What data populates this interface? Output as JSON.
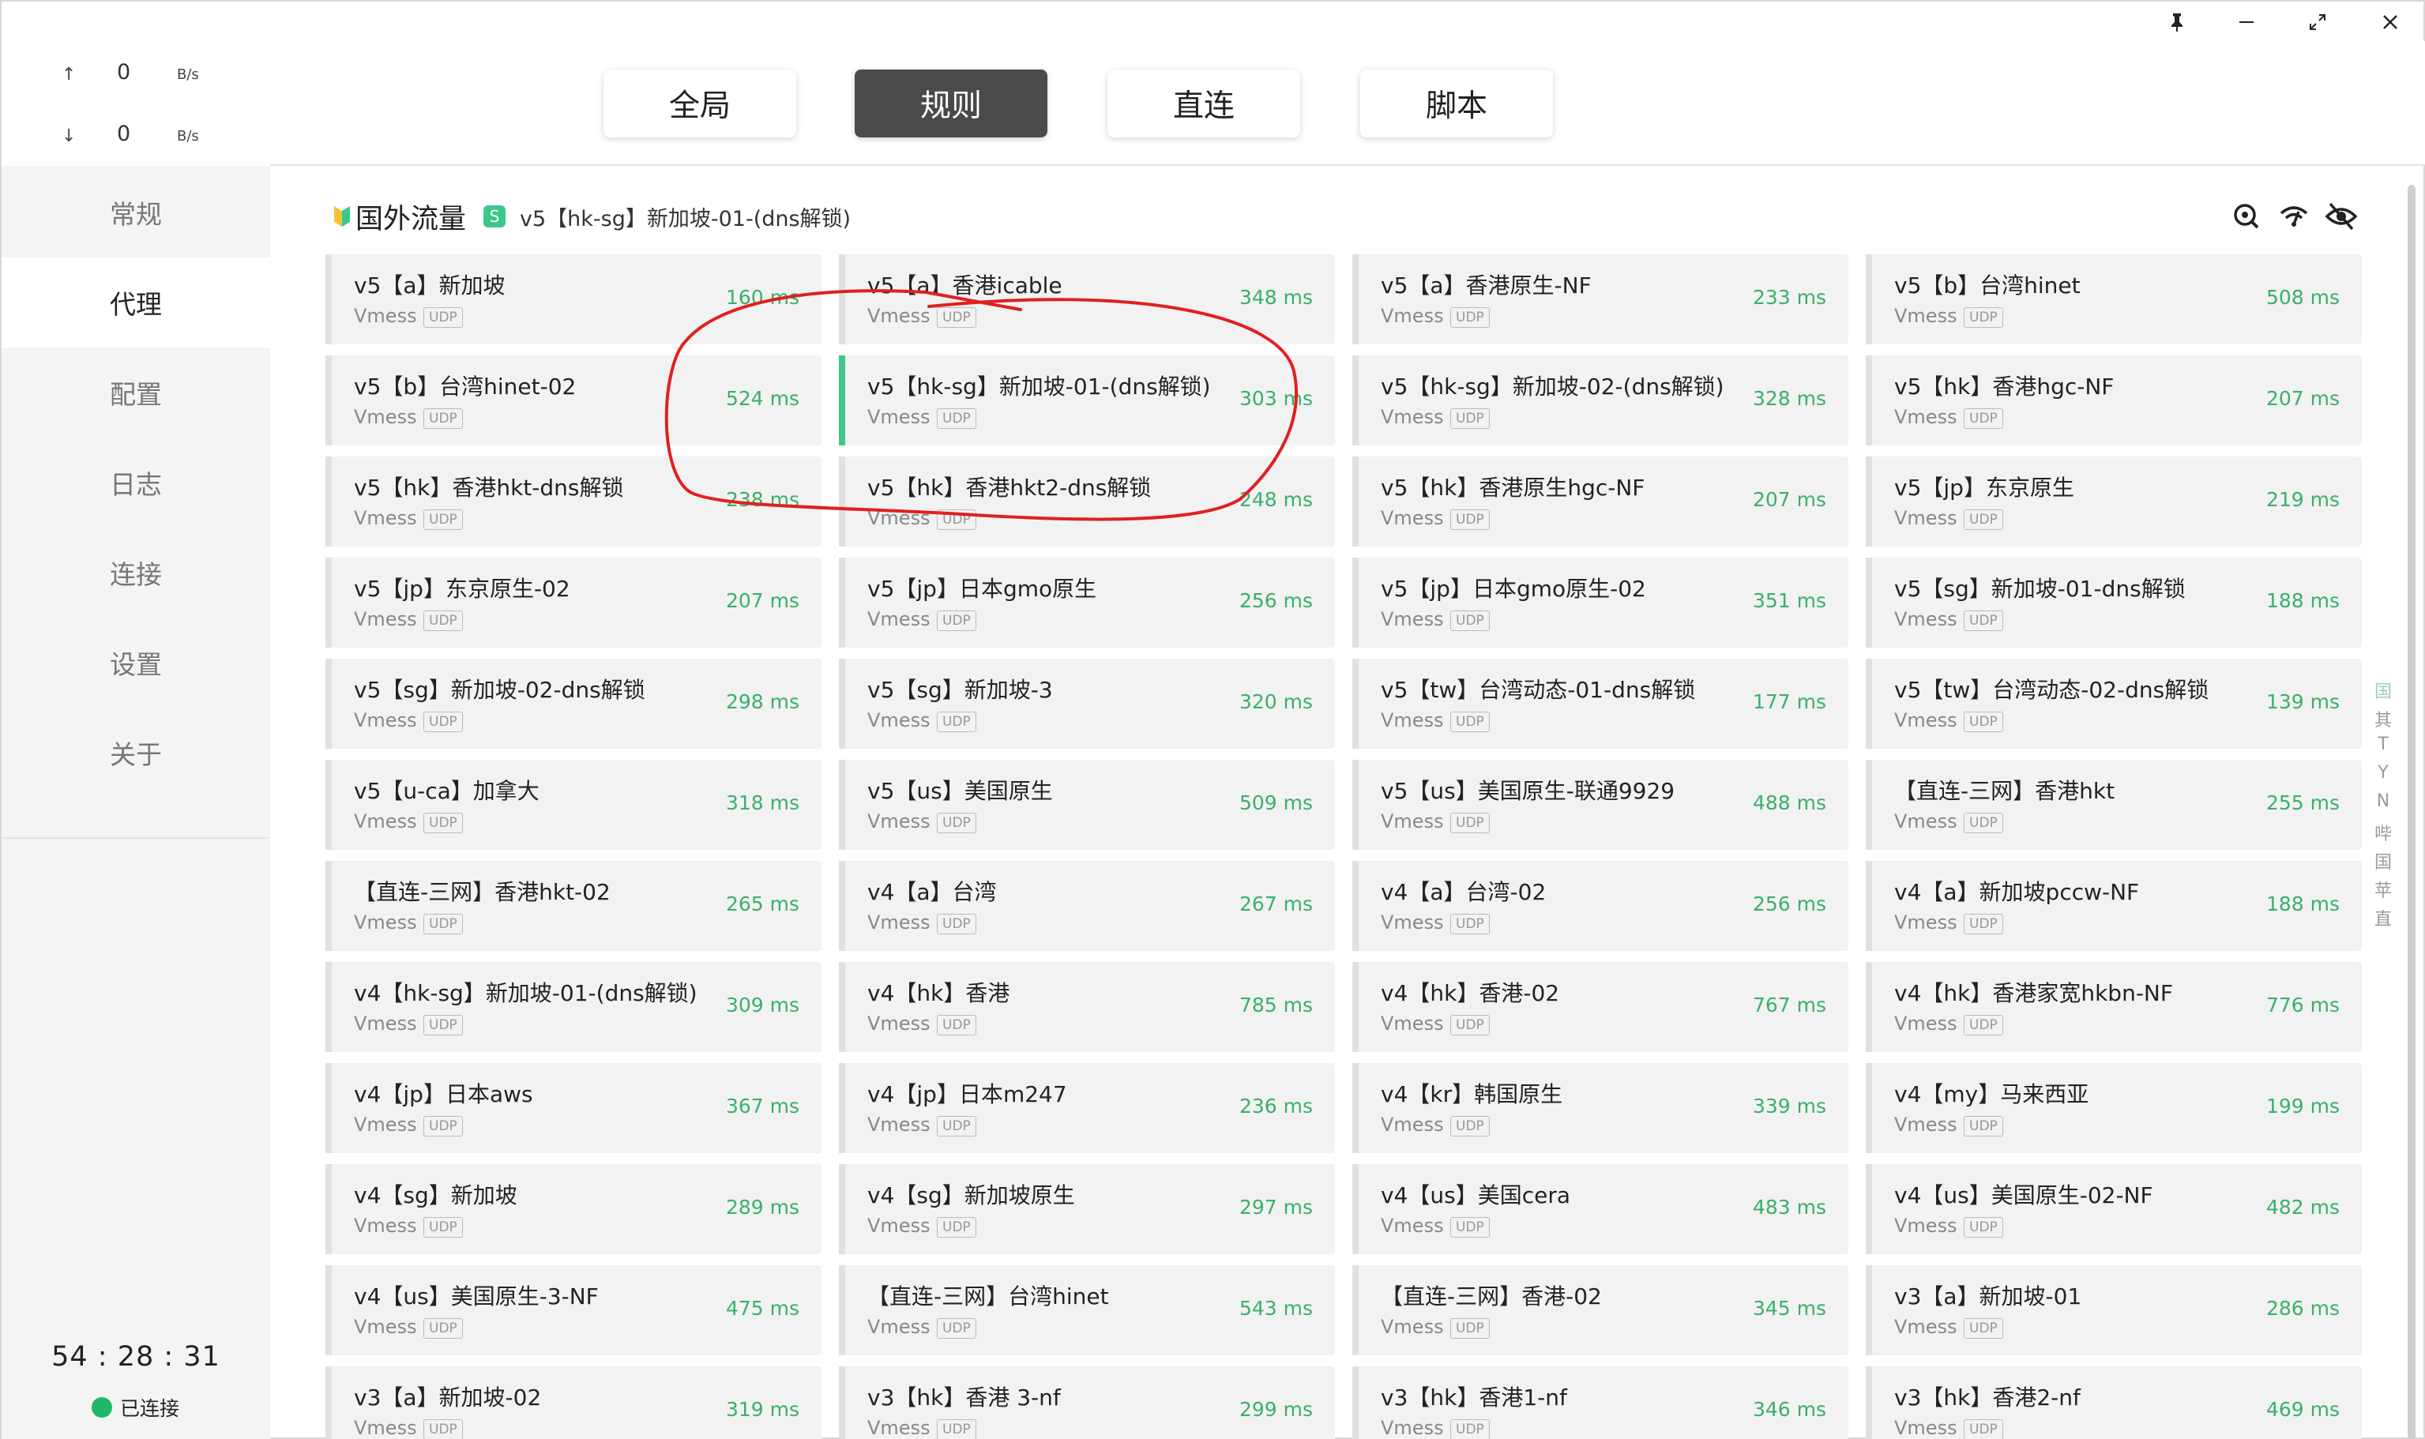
{
  "titlebar": {
    "buttons": [
      {
        "name": "pin-icon",
        "glyph": "📌"
      },
      {
        "name": "minimize-icon",
        "glyph": "—"
      },
      {
        "name": "maximize-icon",
        "glyph": "⤡"
      },
      {
        "name": "close-icon",
        "glyph": "✕"
      }
    ]
  },
  "traffic": {
    "up": {
      "arrow": "↑",
      "value": "0",
      "unit": "B/s"
    },
    "down": {
      "arrow": "↓",
      "value": "0",
      "unit": "B/s"
    }
  },
  "nav": {
    "items": [
      "常规",
      "代理",
      "配置",
      "日志",
      "连接",
      "设置",
      "关于"
    ],
    "active": "代理"
  },
  "timer": "54 : 28 : 31",
  "status": {
    "text": "已连接",
    "color": "#1fb868"
  },
  "modes": {
    "items": [
      "全局",
      "规则",
      "直连",
      "脚本"
    ],
    "active": "规则"
  },
  "group": {
    "name": "国外流量",
    "badge": "S",
    "selected": "v5【hk-sg】新加坡-01-(dns解锁)",
    "icons": [
      "location-search-icon",
      "wifi-speed-icon",
      "eye-off-icon"
    ]
  },
  "colors": {
    "accent": "#3ec78b",
    "delay": "#3ab06a",
    "annotation": "#e02020",
    "active_mode": "#4a4a4a"
  },
  "proxies": [
    {
      "name": "v5【a】新加坡",
      "type": "Vmess",
      "udp": "UDP",
      "delay": "160 ms"
    },
    {
      "name": "v5【a】香港icable",
      "type": "Vmess",
      "udp": "UDP",
      "delay": "348 ms"
    },
    {
      "name": "v5【a】香港原生-NF",
      "type": "Vmess",
      "udp": "UDP",
      "delay": "233 ms"
    },
    {
      "name": "v5【b】台湾hinet",
      "type": "Vmess",
      "udp": "UDP",
      "delay": "508 ms"
    },
    {
      "name": "v5【b】台湾hinet-02",
      "type": "Vmess",
      "udp": "UDP",
      "delay": "524 ms"
    },
    {
      "name": "v5【hk-sg】新加坡-01-(dns解锁)",
      "type": "Vmess",
      "udp": "UDP",
      "delay": "303 ms",
      "selected": true
    },
    {
      "name": "v5【hk-sg】新加坡-02-(dns解锁)",
      "type": "Vmess",
      "udp": "UDP",
      "delay": "328 ms"
    },
    {
      "name": "v5【hk】香港hgc-NF",
      "type": "Vmess",
      "udp": "UDP",
      "delay": "207 ms"
    },
    {
      "name": "v5【hk】香港hkt-dns解锁",
      "type": "Vmess",
      "udp": "UDP",
      "delay": "238 ms"
    },
    {
      "name": "v5【hk】香港hkt2-dns解锁",
      "type": "Vmess",
      "udp": "UDP",
      "delay": "248 ms"
    },
    {
      "name": "v5【hk】香港原生hgc-NF",
      "type": "Vmess",
      "udp": "UDP",
      "delay": "207 ms"
    },
    {
      "name": "v5【jp】东京原生",
      "type": "Vmess",
      "udp": "UDP",
      "delay": "219 ms"
    },
    {
      "name": "v5【jp】东京原生-02",
      "type": "Vmess",
      "udp": "UDP",
      "delay": "207 ms"
    },
    {
      "name": "v5【jp】日本gmo原生",
      "type": "Vmess",
      "udp": "UDP",
      "delay": "256 ms"
    },
    {
      "name": "v5【jp】日本gmo原生-02",
      "type": "Vmess",
      "udp": "UDP",
      "delay": "351 ms"
    },
    {
      "name": "v5【sg】新加坡-01-dns解锁",
      "type": "Vmess",
      "udp": "UDP",
      "delay": "188 ms"
    },
    {
      "name": "v5【sg】新加坡-02-dns解锁",
      "type": "Vmess",
      "udp": "UDP",
      "delay": "298 ms"
    },
    {
      "name": "v5【sg】新加坡-3",
      "type": "Vmess",
      "udp": "UDP",
      "delay": "320 ms"
    },
    {
      "name": "v5【tw】台湾动态-01-dns解锁",
      "type": "Vmess",
      "udp": "UDP",
      "delay": "177 ms"
    },
    {
      "name": "v5【tw】台湾动态-02-dns解锁",
      "type": "Vmess",
      "udp": "UDP",
      "delay": "139 ms"
    },
    {
      "name": "v5【u-ca】加拿大",
      "type": "Vmess",
      "udp": "UDP",
      "delay": "318 ms"
    },
    {
      "name": "v5【us】美国原生",
      "type": "Vmess",
      "udp": "UDP",
      "delay": "509 ms"
    },
    {
      "name": "v5【us】美国原生-联通9929",
      "type": "Vmess",
      "udp": "UDP",
      "delay": "488 ms"
    },
    {
      "name": "【直连-三网】香港hkt",
      "type": "Vmess",
      "udp": "UDP",
      "delay": "255 ms"
    },
    {
      "name": "【直连-三网】香港hkt-02",
      "type": "Vmess",
      "udp": "UDP",
      "delay": "265 ms"
    },
    {
      "name": "v4【a】台湾",
      "type": "Vmess",
      "udp": "UDP",
      "delay": "267 ms"
    },
    {
      "name": "v4【a】台湾-02",
      "type": "Vmess",
      "udp": "UDP",
      "delay": "256 ms"
    },
    {
      "name": "v4【a】新加坡pccw-NF",
      "type": "Vmess",
      "udp": "UDP",
      "delay": "188 ms"
    },
    {
      "name": "v4【hk-sg】新加坡-01-(dns解锁)",
      "type": "Vmess",
      "udp": "UDP",
      "delay": "309 ms"
    },
    {
      "name": "v4【hk】香港",
      "type": "Vmess",
      "udp": "UDP",
      "delay": "785 ms"
    },
    {
      "name": "v4【hk】香港-02",
      "type": "Vmess",
      "udp": "UDP",
      "delay": "767 ms"
    },
    {
      "name": "v4【hk】香港家宽hkbn-NF",
      "type": "Vmess",
      "udp": "UDP",
      "delay": "776 ms"
    },
    {
      "name": "v4【jp】日本aws",
      "type": "Vmess",
      "udp": "UDP",
      "delay": "367 ms"
    },
    {
      "name": "v4【jp】日本m247",
      "type": "Vmess",
      "udp": "UDP",
      "delay": "236 ms"
    },
    {
      "name": "v4【kr】韩国原生",
      "type": "Vmess",
      "udp": "UDP",
      "delay": "339 ms"
    },
    {
      "name": "v4【my】马来西亚",
      "type": "Vmess",
      "udp": "UDP",
      "delay": "199 ms"
    },
    {
      "name": "v4【sg】新加坡",
      "type": "Vmess",
      "udp": "UDP",
      "delay": "289 ms"
    },
    {
      "name": "v4【sg】新加坡原生",
      "type": "Vmess",
      "udp": "UDP",
      "delay": "297 ms"
    },
    {
      "name": "v4【us】美国cera",
      "type": "Vmess",
      "udp": "UDP",
      "delay": "483 ms"
    },
    {
      "name": "v4【us】美国原生-02-NF",
      "type": "Vmess",
      "udp": "UDP",
      "delay": "482 ms"
    },
    {
      "name": "v4【us】美国原生-3-NF",
      "type": "Vmess",
      "udp": "UDP",
      "delay": "475 ms"
    },
    {
      "name": "【直连-三网】台湾hinet",
      "type": "Vmess",
      "udp": "UDP",
      "delay": "543 ms"
    },
    {
      "name": "【直连-三网】香港-02",
      "type": "Vmess",
      "udp": "UDP",
      "delay": "345 ms"
    },
    {
      "name": "v3【a】新加坡-01",
      "type": "Vmess",
      "udp": "UDP",
      "delay": "286 ms"
    },
    {
      "name": "v3【a】新加坡-02",
      "type": "Vmess",
      "udp": "UDP",
      "delay": "319 ms"
    },
    {
      "name": "v3【hk】香港 3-nf",
      "type": "Vmess",
      "udp": "UDP",
      "delay": "299 ms"
    },
    {
      "name": "v3【hk】香港1-nf",
      "type": "Vmess",
      "udp": "UDP",
      "delay": "346 ms"
    },
    {
      "name": "v3【hk】香港2-nf",
      "type": "Vmess",
      "udp": "UDP",
      "delay": "469 ms"
    }
  ],
  "index_letters": [
    "国",
    "其",
    "T",
    "Y",
    "N",
    "哔",
    "国",
    "苹",
    "直"
  ]
}
